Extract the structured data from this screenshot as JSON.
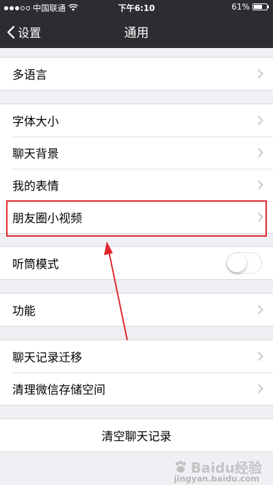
{
  "status_bar": {
    "carrier": "中国联通",
    "time": "下午6:10",
    "battery_percent": "61%",
    "battery_level": 0.61
  },
  "nav": {
    "back_label": "设置",
    "title": "通用"
  },
  "groups": [
    {
      "items": [
        "多语言"
      ]
    },
    {
      "items": [
        "字体大小",
        "聊天背景",
        "我的表情",
        "朋友圈小视频"
      ]
    },
    {
      "items": [
        "听筒模式"
      ]
    },
    {
      "items": [
        "功能"
      ]
    },
    {
      "items": [
        "聊天记录迁移",
        "清理微信存储空间"
      ]
    },
    {
      "items": [
        "清空聊天记录"
      ]
    }
  ],
  "toggles": {
    "earpiece_mode": false
  },
  "annotation": {
    "highlight_color": "#e0262b"
  },
  "watermark": {
    "text": "Baidu经验",
    "sub": "jingyan.baidu.com"
  }
}
